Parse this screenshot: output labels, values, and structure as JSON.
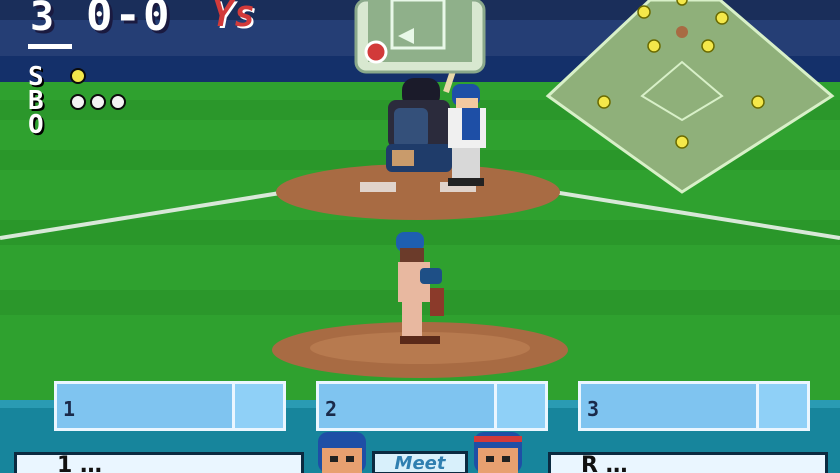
{
  "hud": {
    "inning": "3",
    "score": "0-0",
    "team_logo": "Ys",
    "count_labels": [
      "S",
      "B",
      "O"
    ],
    "strikes": 1,
    "balls": 3,
    "outs": 0
  },
  "action_slots": [
    {
      "label": "1"
    },
    {
      "label": "2"
    },
    {
      "label": "3"
    }
  ],
  "bottom": {
    "left_player": "1 …",
    "center_label": "Meet",
    "right_player": "R …"
  },
  "colors": {
    "ball_yellow": "#f4e84a",
    "ball_empty": "#f4f4f4",
    "grass": "#2fa12f",
    "dirt": "#a86b43",
    "slot_blue": "#7fc4f0",
    "runner_red": "#d23a3a"
  }
}
